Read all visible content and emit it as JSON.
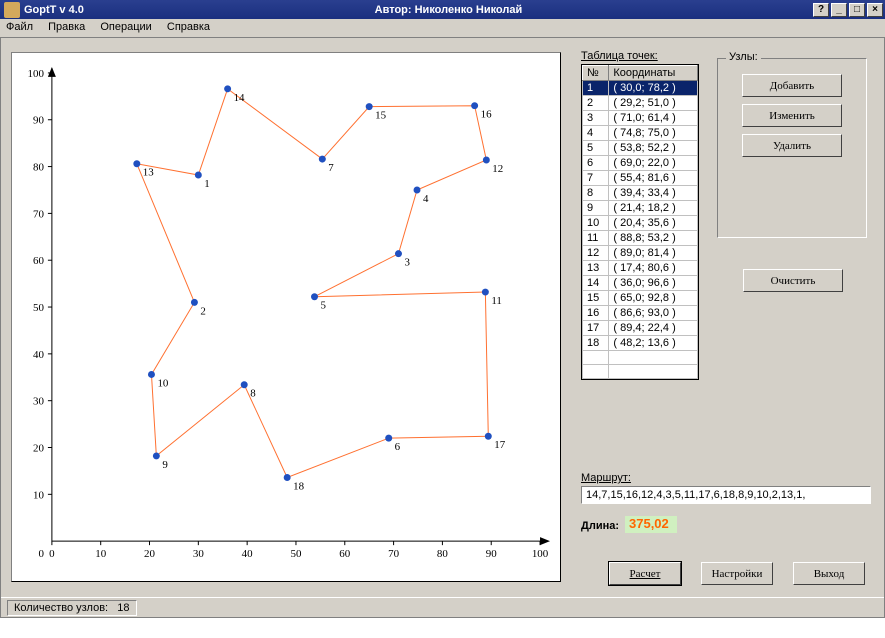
{
  "window": {
    "title_left": "GoptT v 4.0",
    "title_center": "Автор: Николенко Николай"
  },
  "menu": [
    "Файл",
    "Правка",
    "Операции",
    "Справка"
  ],
  "table": {
    "caption": "Таблица точек:",
    "headers": [
      "№",
      "Координаты"
    ],
    "selected_index": 0,
    "rows": [
      {
        "n": "1",
        "coord": "( 30,0; 78,2 )"
      },
      {
        "n": "2",
        "coord": "( 29,2; 51,0 )"
      },
      {
        "n": "3",
        "coord": "( 71,0; 61,4 )"
      },
      {
        "n": "4",
        "coord": "( 74,8; 75,0 )"
      },
      {
        "n": "5",
        "coord": "( 53,8; 52,2 )"
      },
      {
        "n": "6",
        "coord": "( 69,0; 22,0 )"
      },
      {
        "n": "7",
        "coord": "( 55,4; 81,6 )"
      },
      {
        "n": "8",
        "coord": "( 39,4; 33,4 )"
      },
      {
        "n": "9",
        "coord": "( 21,4; 18,2 )"
      },
      {
        "n": "10",
        "coord": "( 20,4; 35,6 )"
      },
      {
        "n": "11",
        "coord": "( 88,8; 53,2 )"
      },
      {
        "n": "12",
        "coord": "( 89,0; 81,4 )"
      },
      {
        "n": "13",
        "coord": "( 17,4; 80,6 )"
      },
      {
        "n": "14",
        "coord": "( 36,0; 96,6 )"
      },
      {
        "n": "15",
        "coord": "( 65,0; 92,8 )"
      },
      {
        "n": "16",
        "coord": "( 86,6; 93,0 )"
      },
      {
        "n": "17",
        "coord": "( 89,4; 22,4 )"
      },
      {
        "n": "18",
        "coord": "( 48,2; 13,6 )"
      }
    ]
  },
  "group_nodes": {
    "legend": "Узлы:",
    "add": "Добавить",
    "edit": "Изменить",
    "delete": "Удалить",
    "clear": "Очистить"
  },
  "route": {
    "label": "Маршрут:",
    "value": "14,7,15,16,12,4,3,5,11,17,6,18,8,9,10,2,13,1,",
    "length_label": "Длина:",
    "length_value": "375,02"
  },
  "buttons": {
    "calc": "Расчет",
    "settings": "Настройки",
    "exit": "Выход"
  },
  "status": {
    "label": "Количество узлов:",
    "value": "18"
  },
  "chart_data": {
    "type": "scatter",
    "xlim": [
      0,
      100
    ],
    "ylim": [
      0,
      100
    ],
    "xticks": [
      0,
      10,
      20,
      30,
      40,
      50,
      60,
      70,
      80,
      90,
      100
    ],
    "yticks": [
      10,
      20,
      30,
      40,
      50,
      60,
      70,
      80,
      90,
      100
    ],
    "points": [
      {
        "id": 1,
        "x": 30.0,
        "y": 78.2
      },
      {
        "id": 2,
        "x": 29.2,
        "y": 51.0
      },
      {
        "id": 3,
        "x": 71.0,
        "y": 61.4
      },
      {
        "id": 4,
        "x": 74.8,
        "y": 75.0
      },
      {
        "id": 5,
        "x": 53.8,
        "y": 52.2
      },
      {
        "id": 6,
        "x": 69.0,
        "y": 22.0
      },
      {
        "id": 7,
        "x": 55.4,
        "y": 81.6
      },
      {
        "id": 8,
        "x": 39.4,
        "y": 33.4
      },
      {
        "id": 9,
        "x": 21.4,
        "y": 18.2
      },
      {
        "id": 10,
        "x": 20.4,
        "y": 35.6
      },
      {
        "id": 11,
        "x": 88.8,
        "y": 53.2
      },
      {
        "id": 12,
        "x": 89.0,
        "y": 81.4
      },
      {
        "id": 13,
        "x": 17.4,
        "y": 80.6
      },
      {
        "id": 14,
        "x": 36.0,
        "y": 96.6
      },
      {
        "id": 15,
        "x": 65.0,
        "y": 92.8
      },
      {
        "id": 16,
        "x": 86.6,
        "y": 93.0
      },
      {
        "id": 17,
        "x": 89.4,
        "y": 22.4
      },
      {
        "id": 18,
        "x": 48.2,
        "y": 13.6
      }
    ],
    "route_order": [
      14,
      7,
      15,
      16,
      12,
      4,
      3,
      5,
      11,
      17,
      6,
      18,
      8,
      9,
      10,
      2,
      13,
      1
    ]
  }
}
